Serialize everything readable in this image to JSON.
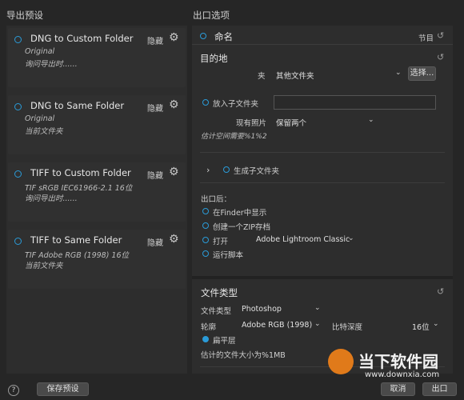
{
  "left_header": "导出预设",
  "right_header": "出口选项",
  "presets": [
    {
      "name": "DNG to Custom Folder",
      "hide": "隐藏",
      "line1": "Original",
      "line2": "询问导出时......"
    },
    {
      "name": "DNG to Same Folder",
      "hide": "隐藏",
      "line1": "Original",
      "line2": "当前文件夹"
    },
    {
      "name": "TIFF to Custom Folder",
      "hide": "隐藏",
      "line1": "TIF  sRGB IEC61966-2.1  16位",
      "line2": "询问导出时......"
    },
    {
      "name": "TIFF to Same Folder",
      "hide": "隐藏",
      "line1": "TIF  Adobe RGB (1998)  16位",
      "line2": "当前文件夹"
    }
  ],
  "save_preset": "保存预设",
  "naming": {
    "title": "命名",
    "right": "节目"
  },
  "destination": {
    "title": "目的地",
    "folder_label": "夹",
    "folder_value": "其他文件夹",
    "choose_btn": "选择...",
    "subfolder_label": "放入子文件夹",
    "existing_label": "现有照片",
    "existing_value": "保留两个",
    "space_estimate": "估计空间需要%1%2",
    "gen_subfolder": "生成子文件夹"
  },
  "after_export": {
    "title": "出口后：",
    "options": [
      "在Finder中显示",
      "创建一个ZIP存档",
      "打开",
      "运行脚本"
    ],
    "open_app": "Adobe Lightroom Classic"
  },
  "file_type": {
    "title": "文件类型",
    "type_label": "文件类型",
    "type_value": "Photoshop",
    "profile_label": "轮廓",
    "profile_value": "Adobe RGB (1998)",
    "bitdepth_label": "比特深度",
    "bitdepth_value": "16位",
    "flatten": "扁平层",
    "size_estimate": "估计的文件大小为%1MB"
  },
  "footer": {
    "help": "?",
    "cancel": "取消",
    "export": "出口"
  },
  "watermark": {
    "name": "当下软件园",
    "url": "www.downxia.com"
  },
  "colors": {
    "accent": "#2a9bd8",
    "bg": "#262626"
  }
}
